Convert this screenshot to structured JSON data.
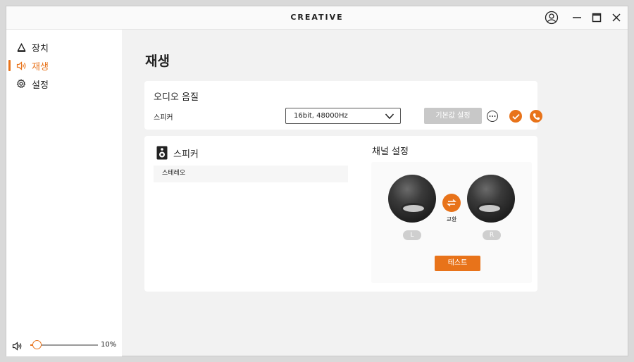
{
  "window": {
    "brand": "CREATIVE",
    "icons": [
      "user-icon",
      "minimize-icon",
      "maximize-icon",
      "close-icon"
    ]
  },
  "sidebar": {
    "items": [
      {
        "label": "장치",
        "icon": "device-icon",
        "active": false
      },
      {
        "label": "재생",
        "icon": "speaker-wave-icon",
        "active": true
      },
      {
        "label": "설정",
        "icon": "gear-icon",
        "active": false
      }
    ],
    "volume": {
      "value": 0.1,
      "label": "10%"
    }
  },
  "main": {
    "title": "재생",
    "audio_quality": {
      "title": "오디오 음질",
      "device_label": "스피커",
      "format_value": "16bit, 48000Hz",
      "default_button": "기본값 설정"
    },
    "speaker_card": {
      "title": "스피커",
      "mode": "스테레오"
    },
    "channel": {
      "title": "채널 설정",
      "left_label": "L",
      "right_label": "R",
      "swap_label": "교환",
      "test_button": "테스트"
    }
  },
  "colors": {
    "accent": "#e8731a",
    "disabled": "#c8c8c8"
  }
}
